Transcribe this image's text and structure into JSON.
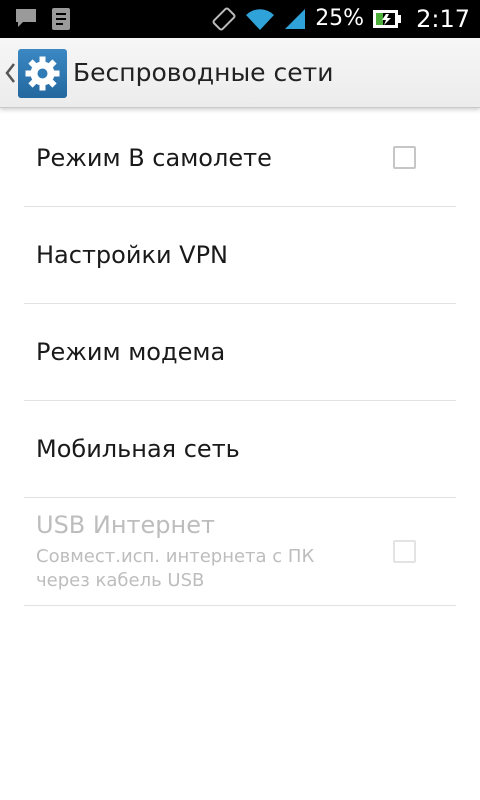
{
  "status_bar": {
    "battery_percent": "25%",
    "time": "2:17",
    "icons": [
      "chat-icon",
      "notes-icon",
      "rotate-icon",
      "wifi-icon",
      "signal-icon",
      "battery-icon"
    ]
  },
  "action_bar": {
    "title": "Беспроводные сети",
    "icon": "settings-gear-icon",
    "accent_color": "#2f7bb6"
  },
  "list": {
    "airplane": {
      "title": "Режим В самолете",
      "checked": false
    },
    "vpn": {
      "title": "Настройки VPN"
    },
    "modem": {
      "title": "Режим модема"
    },
    "mobile": {
      "title": "Мобильная сеть"
    },
    "usb": {
      "title": "USB Интернет",
      "summary": "Совмест.исп. интернета с ПК через кабель USB",
      "enabled": false,
      "checked": false
    }
  }
}
